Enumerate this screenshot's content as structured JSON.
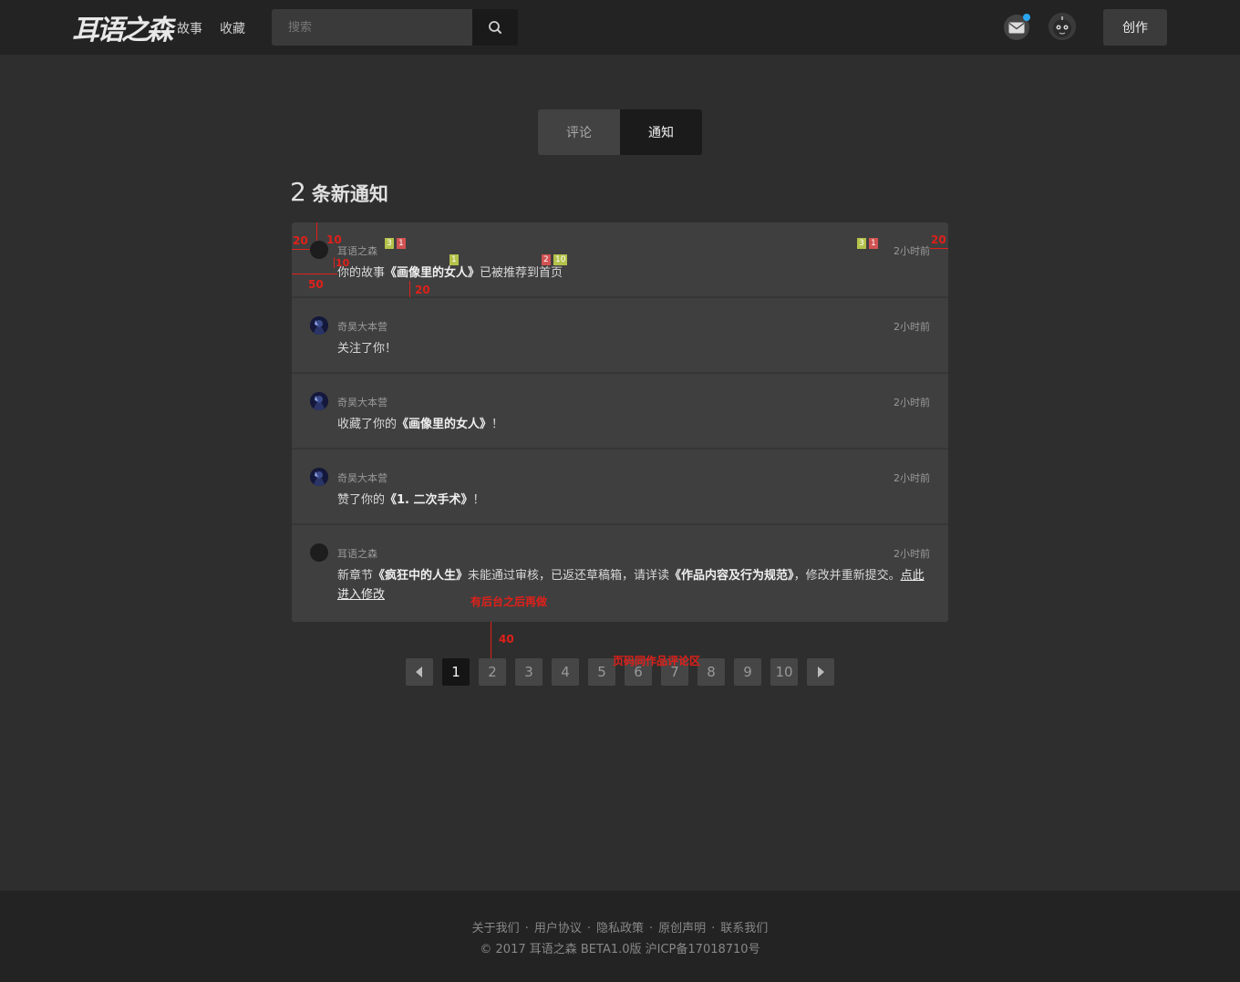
{
  "header": {
    "logo": "耳语之森",
    "nav": [
      "故事",
      "收藏"
    ],
    "search_placeholder": "搜索",
    "create_label": "创作",
    "mail_unread": true
  },
  "tabs": [
    {
      "label": "评论",
      "active": false
    },
    {
      "label": "通知",
      "active": true
    }
  ],
  "heading": {
    "count": "2",
    "label": "条新通知"
  },
  "notifications": [
    {
      "user": "耳语之森",
      "time": "2小时前",
      "parts": [
        "你的故事",
        "《画像里的女人》",
        "已被推荐到首页"
      ]
    },
    {
      "user": "奇昊大本营",
      "time": "2小时前",
      "parts": [
        "关注了你！"
      ]
    },
    {
      "user": "奇昊大本营",
      "time": "2小时前",
      "parts": [
        "收藏了你的",
        "《画像里的女人》",
        "！"
      ]
    },
    {
      "user": "奇昊大本营",
      "time": "2小时前",
      "parts": [
        "赞了你的",
        "《1. 二次手术》",
        "！"
      ]
    },
    {
      "user": "耳语之森",
      "time": "2小时前",
      "parts": [
        "新章节",
        "《疯狂中的人生》",
        "未能通过审核，已返还草稿箱，请详读",
        "《作品内容及行为规范》",
        "，修改并重新提交。",
        "点此进入修改"
      ]
    }
  ],
  "annotations": {
    "left_pad": "20",
    "top_pad": "10",
    "name_gap": "10",
    "right_pad": "20",
    "indent": "50",
    "bottom_pad": "20",
    "backend_note": "有后台之后再做",
    "pager_gap": "40",
    "pager_note": "页码同作品评论区",
    "badges_a": [
      "3",
      "1"
    ],
    "badge_b": "1",
    "badges_c": [
      "2",
      "10"
    ],
    "badges_d": [
      "3",
      "1"
    ]
  },
  "pagination": {
    "pages": [
      "1",
      "2",
      "3",
      "4",
      "5",
      "6",
      "7",
      "8",
      "9",
      "10"
    ],
    "current": "1"
  },
  "footer": {
    "links": [
      "关于我们",
      "用户协议",
      "隐私政策",
      "原创声明",
      "联系我们"
    ],
    "separator": "·",
    "copyright": "© 2017 耳语之森 BETA1.0版 沪ICP备17018710号"
  },
  "colors": {
    "background": "#2e2e2e",
    "header": "#232323",
    "panel": "#3f3f3f",
    "accent_annotation": "#e0201a",
    "unread_dot": "#29a7f0"
  }
}
